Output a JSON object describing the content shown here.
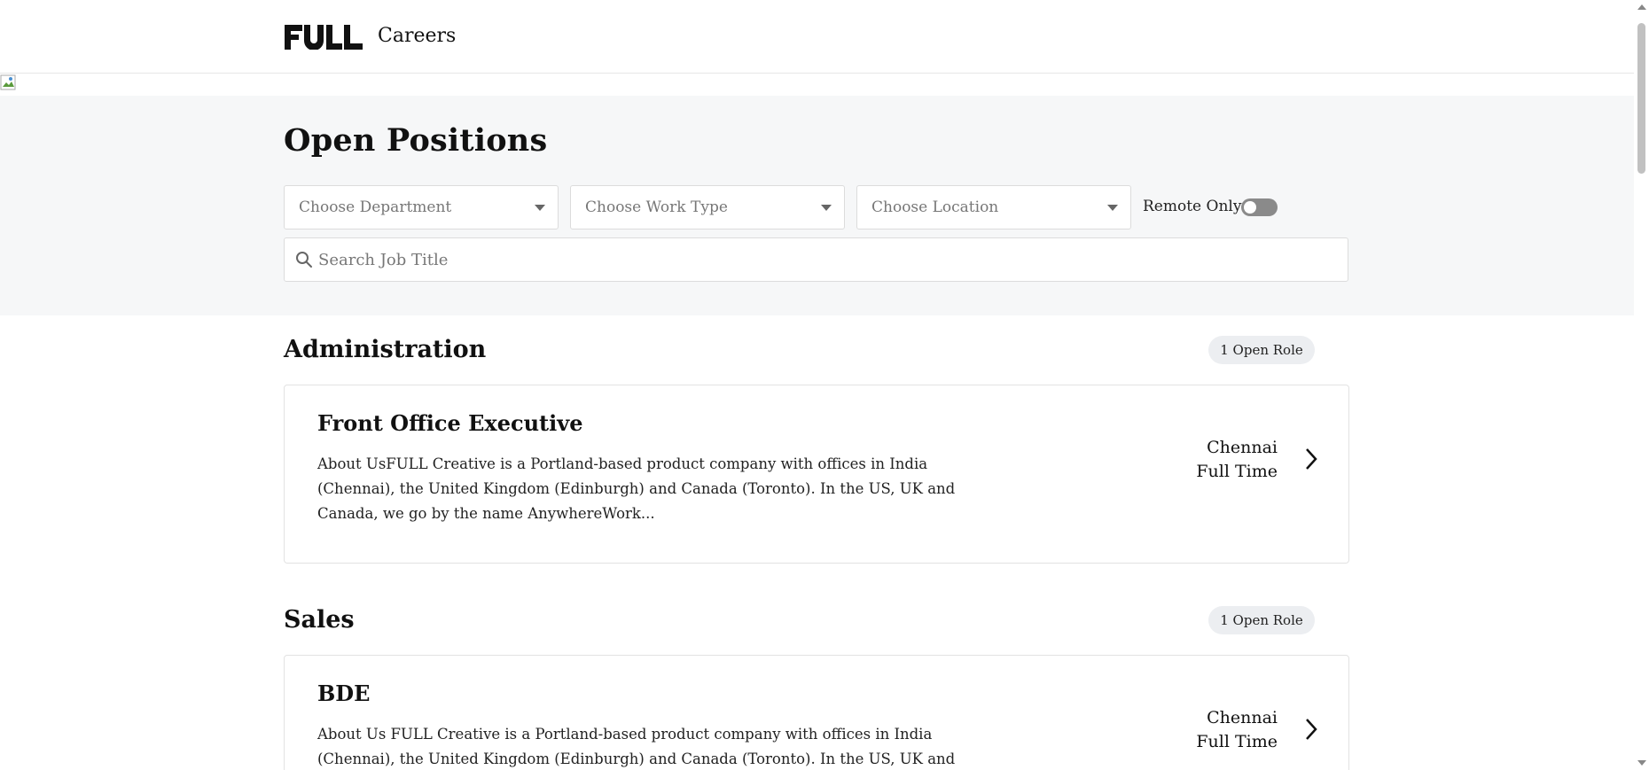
{
  "header": {
    "logo_text": "FULL",
    "title": "Careers"
  },
  "main": {
    "page_title": "Open Positions",
    "filters": {
      "department_placeholder": "Choose Department",
      "work_type_placeholder": "Choose Work Type",
      "location_placeholder": "Choose Location",
      "remote_only_label": "Remote Only",
      "remote_only_value": false
    },
    "search": {
      "placeholder": "Search Job Title"
    },
    "departments": [
      {
        "name": "Administration",
        "badge": "1 Open Role",
        "jobs": [
          {
            "title": "Front Office Executive",
            "description": "About UsFULL Creative is a Portland-based product company with offices in India (Chennai), the United Kingdom (Edinburgh) and Canada (Toronto). In the US, UK and Canada, we go by the name AnywhereWork...",
            "location": "Chennai",
            "work_type": "Full Time"
          }
        ]
      },
      {
        "name": "Sales",
        "badge": "1 Open Role",
        "jobs": [
          {
            "title": "BDE",
            "description": "About Us FULL Creative is a Portland-based product company with offices in India (Chennai), the United Kingdom (Edinburgh) and Canada (Toronto). In the US, UK and Canada, we go by the name Anywhe...",
            "location": "Chennai",
            "work_type": "Full Time"
          }
        ]
      }
    ]
  },
  "icons": {
    "search": "search-icon",
    "chevron": "chevron-right-icon",
    "dropdown": "caret-down-icon"
  },
  "colors": {
    "hero_background": "#f6f7f8",
    "badge_background": "#eceef1",
    "toggle_off": "#8a8a8a"
  }
}
